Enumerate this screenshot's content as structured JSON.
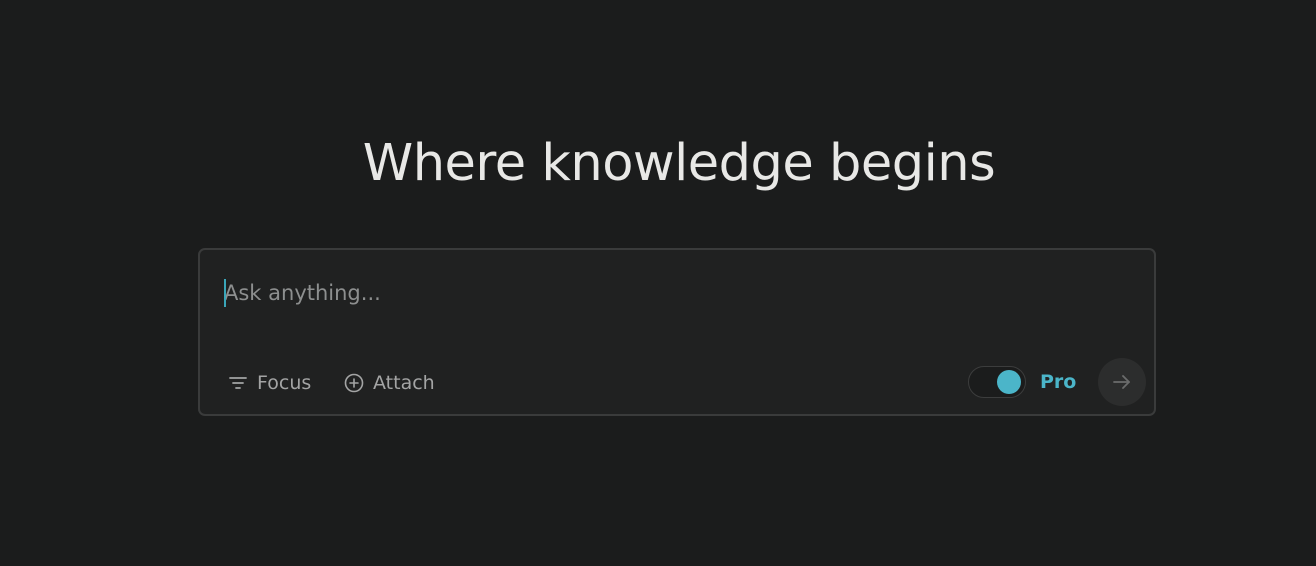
{
  "hero": {
    "title": "Where knowledge begins"
  },
  "search": {
    "placeholder": "Ask anything...",
    "value": ""
  },
  "toolbar": {
    "focus_label": "Focus",
    "focus_icon": "filter-icon",
    "attach_label": "Attach",
    "attach_icon": "plus-circle-icon",
    "pro_label": "Pro",
    "pro_enabled": true,
    "submit_icon": "arrow-right-icon"
  },
  "colors": {
    "background": "#1b1c1c",
    "accent": "#4bb5c9",
    "text": "#e8e8e6",
    "muted": "#a3a4a4"
  }
}
